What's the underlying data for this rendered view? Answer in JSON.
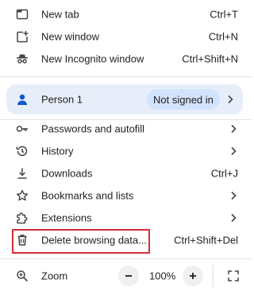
{
  "menu": {
    "new_tab": {
      "label": "New tab",
      "shortcut": "Ctrl+T"
    },
    "new_window": {
      "label": "New window",
      "shortcut": "Ctrl+N"
    },
    "new_incognito": {
      "label": "New Incognito window",
      "shortcut": "Ctrl+Shift+N"
    },
    "profile": {
      "name": "Person 1",
      "status": "Not signed in"
    },
    "passwords": {
      "label": "Passwords and autofill"
    },
    "history": {
      "label": "History"
    },
    "downloads": {
      "label": "Downloads",
      "shortcut": "Ctrl+J"
    },
    "bookmarks": {
      "label": "Bookmarks and lists"
    },
    "extensions": {
      "label": "Extensions"
    },
    "delete_data": {
      "label": "Delete browsing data...",
      "shortcut": "Ctrl+Shift+Del"
    },
    "zoom": {
      "label": "Zoom",
      "value": "100%"
    }
  },
  "icons": {
    "new_tab": "new-tab-icon",
    "new_window": "new-window-icon",
    "incognito": "incognito-icon",
    "person": "person-icon",
    "key": "key-icon",
    "history": "history-icon",
    "download": "download-icon",
    "star": "star-icon",
    "puzzle": "puzzle-icon",
    "trash": "trash-icon",
    "zoom": "zoom-icon",
    "fullscreen": "fullscreen-icon"
  },
  "colors": {
    "profile_bg": "#e8eef9",
    "pill_bg": "#d3e3fd",
    "highlight": "#d92c3a"
  }
}
